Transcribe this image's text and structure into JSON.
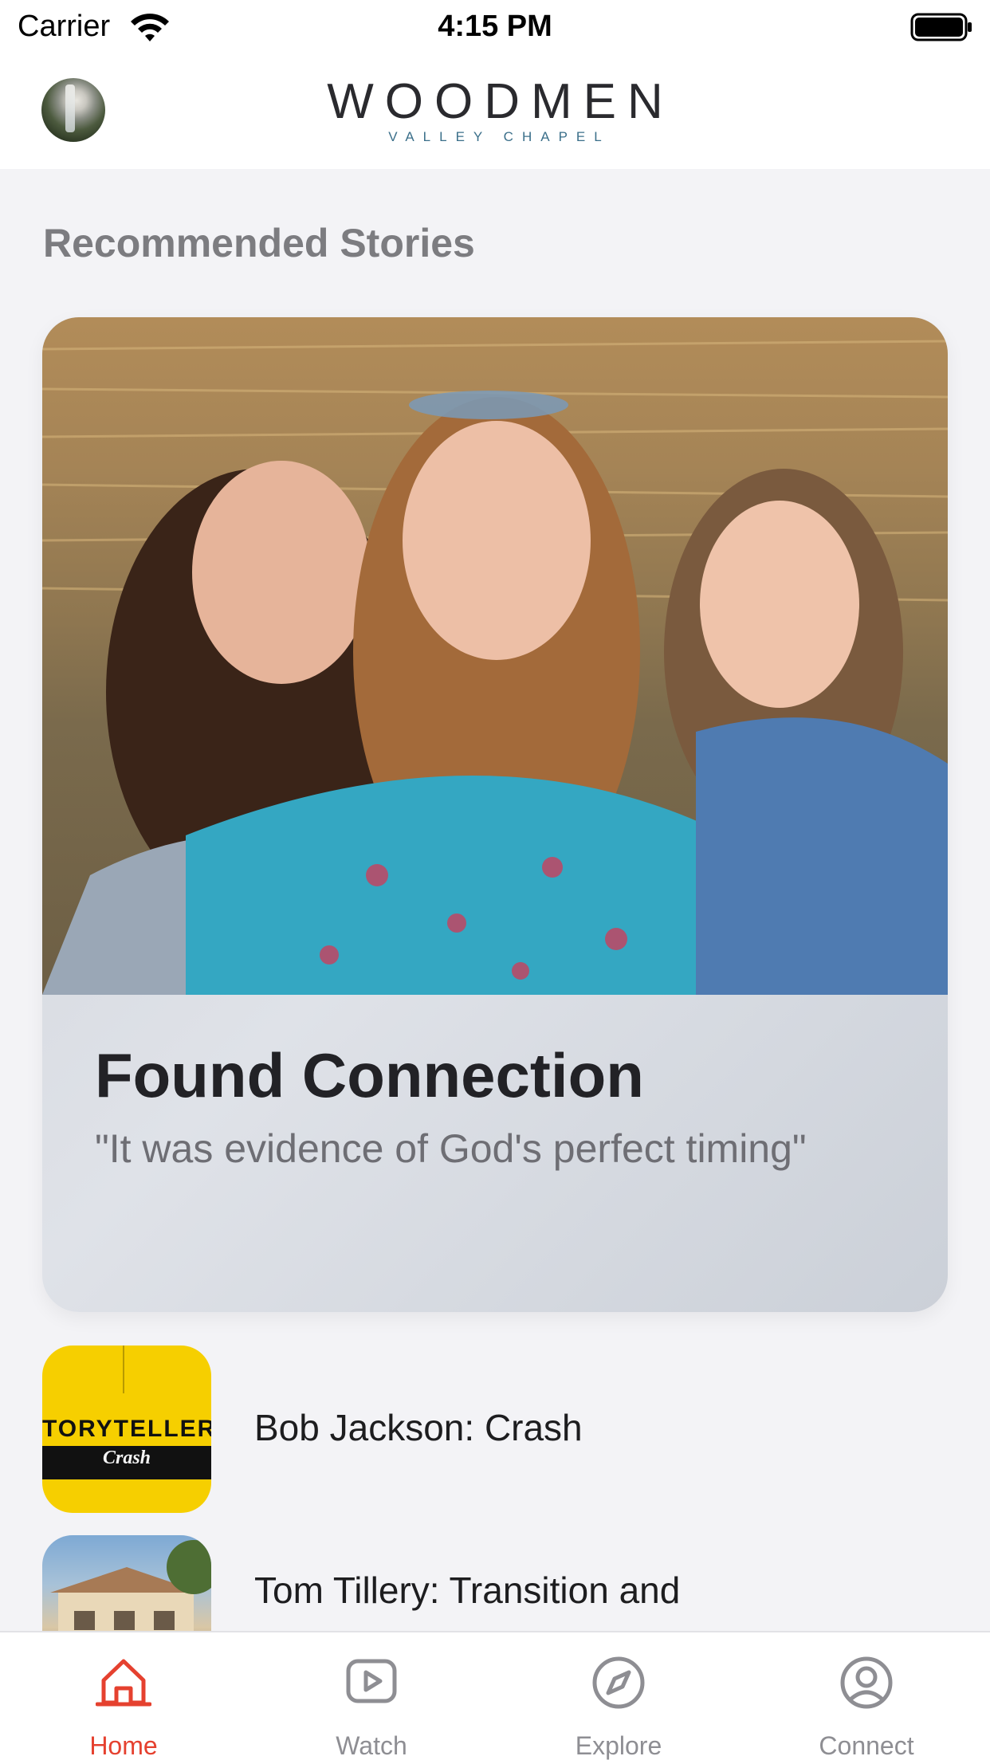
{
  "status_bar": {
    "carrier": "Carrier",
    "time": "4:15 PM",
    "icons": [
      "wifi-icon",
      "battery-icon"
    ]
  },
  "header": {
    "logo_main": "WOODMEN",
    "logo_sub": "VALLEY CHAPEL",
    "avatar": "profile-avatar"
  },
  "main": {
    "section_title": "Recommended Stories",
    "featured": {
      "title": "Found Connection",
      "quote": "\"It was evidence of God's perfect timing\"",
      "image": "three-women-selfie-photo"
    },
    "stories": [
      {
        "title": "Bob Jackson: Crash",
        "thumb_text": "TORYTELLERS",
        "thumb_sub": "Crash"
      },
      {
        "title": "Tom Tillery: Transition and",
        "thumb": "house-photo"
      }
    ]
  },
  "tab_bar": {
    "items": [
      {
        "label": "Home",
        "icon": "home-icon",
        "active": true
      },
      {
        "label": "Watch",
        "icon": "play-icon",
        "active": false
      },
      {
        "label": "Explore",
        "icon": "compass-icon",
        "active": false
      },
      {
        "label": "Connect",
        "icon": "user-icon",
        "active": false
      }
    ]
  },
  "colors": {
    "accent": "#e5412f",
    "inactive": "#8e8e93",
    "background": "#f3f3f6",
    "section_title": "#7c7c80"
  }
}
